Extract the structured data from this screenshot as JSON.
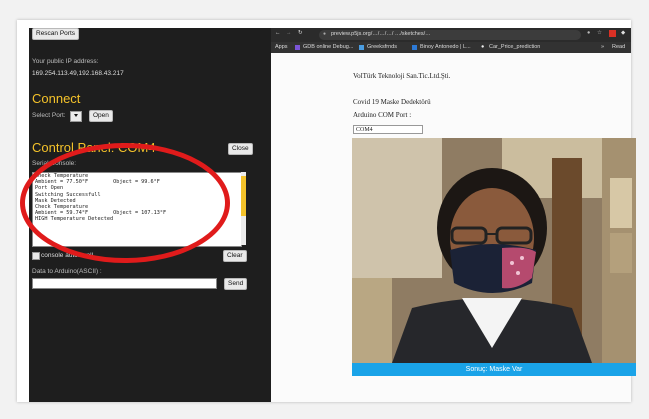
{
  "left": {
    "rescan_label": "Rescan Ports",
    "ip_label": "Your public IP address:",
    "ip_value": "169.254.113.49,192.168.43.217",
    "connect_heading": "Connect",
    "select_port_label": "Select Port:",
    "open_label": "Open",
    "control_heading": "Control Panel: COM4",
    "close_label": "Close",
    "serial_console_label": "Serial Console:",
    "console_lines": [
      "Check Temperature",
      "Ambient = 77.50°F        Object = 99.6°F",
      "Port Open",
      "Switching Successfull",
      "Mask Detected",
      "Check Temperature",
      "Ambient = 59.74°F        Object = 107.13°F",
      "HIGH Temperature Detected"
    ],
    "autoscroll_label": "console autoscroll",
    "clear_label": "Clear",
    "data_label": "Data to Arduino(ASCII) :",
    "send_label": "Send"
  },
  "browser": {
    "url": "preview.p5js.org/…/…/…/ …/sketches/…",
    "bookmarks": [
      "Apps",
      "GDB online Debug...",
      "Greeksfrnds",
      "Binoy Antonedo | L...",
      "Car_Price_prediction",
      "Read"
    ],
    "company": "VolTürk Teknoloji San.Tic.Ltd.Şti.",
    "project_title": "Covid 19 Maske Dedektörü",
    "com_label": "Arduino COM Port :",
    "com_value": "COM4",
    "result": "Sonuç: Maske Var"
  }
}
